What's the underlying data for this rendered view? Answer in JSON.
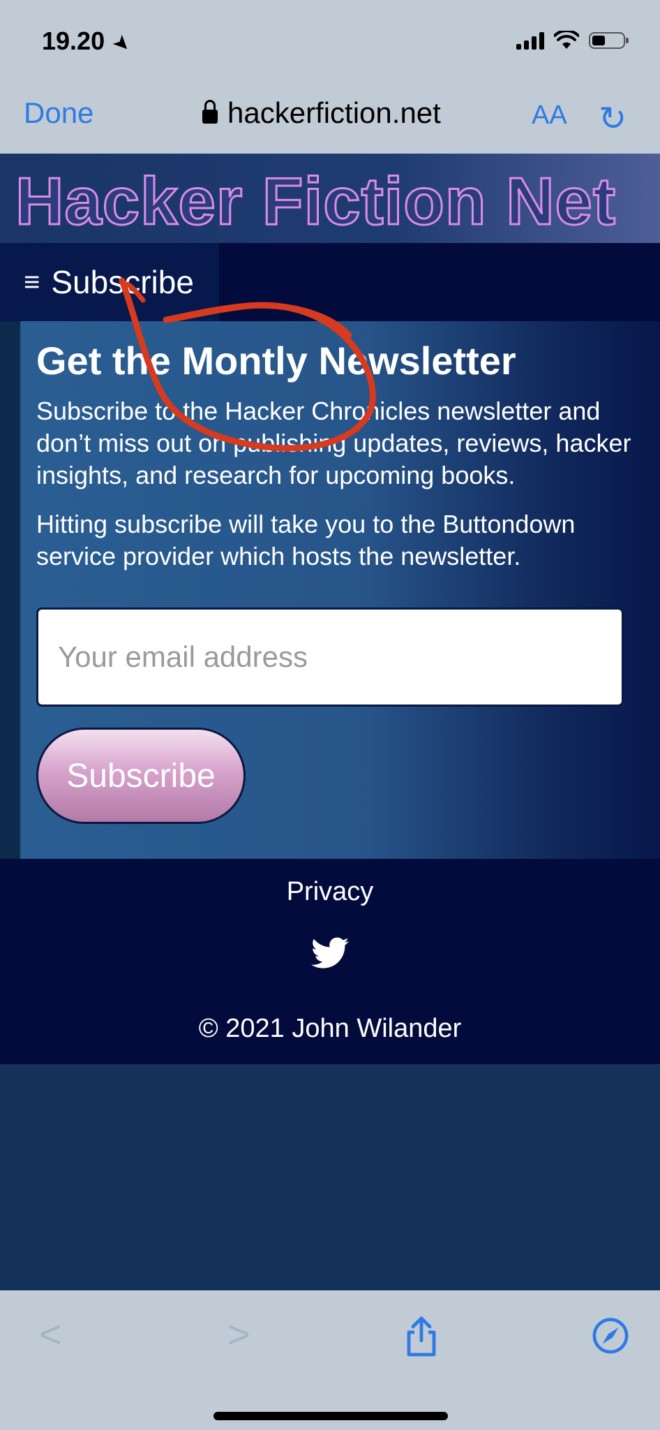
{
  "status": {
    "time": "19.20"
  },
  "browser": {
    "done_label": "Done",
    "url": "hackerfiction.net",
    "text_size_label": "AA"
  },
  "site": {
    "title": "Hacker Fiction Net",
    "nav": {
      "menu_label": "Subscribe"
    }
  },
  "newsletter": {
    "heading": "Get the Montly Newsletter",
    "intro": "Subscribe to the Hacker Chronicles newsletter and don’t miss out on publishing updates, reviews, hacker insights, and research for upcoming books.",
    "note": "Hitting subscribe will take you to the Buttondown service provider which hosts the newsletter.",
    "email_placeholder": "Your email address",
    "subscribe_label": "Subscribe"
  },
  "footer": {
    "privacy": "Privacy",
    "copyright": "© 2021 John Wilander"
  },
  "annotation": {
    "color": "#d73a1e"
  }
}
